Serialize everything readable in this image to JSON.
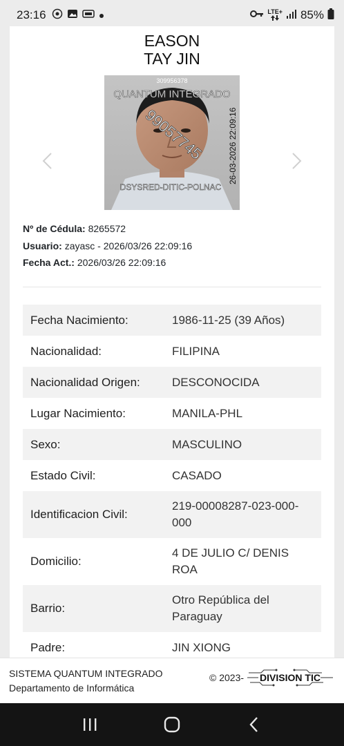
{
  "status_bar": {
    "time": "23:16",
    "lte_top": "LTE+",
    "battery": "85%"
  },
  "person": {
    "first_name": "EASON",
    "last_name": "TAY JIN"
  },
  "photo_overlay": {
    "top_number": "309956378",
    "system": "QUANTUM INTEGRADO",
    "diagonal_id": "99057745",
    "timestamp": "26-03-2026 22:09:16",
    "footer": "DSYSRED-DITIC-POLNAC"
  },
  "meta": {
    "cedula_label": "Nº de Cédula:",
    "cedula_value": "8265572",
    "usuario_label": "Usuario:",
    "usuario_value": "zayasc - 2026/03/26 22:09:16",
    "fecha_label": "Fecha Act.:",
    "fecha_value": "2026/03/26 22:09:16"
  },
  "details": [
    {
      "label": "Fecha Nacimiento:",
      "value": "1986-11-25 (39 Años)"
    },
    {
      "label": "Nacionalidad:",
      "value": "FILIPINA"
    },
    {
      "label": "Nacionalidad Origen:",
      "value": "DESCONOCIDA"
    },
    {
      "label": "Lugar Nacimiento:",
      "value": "MANILA-PHL"
    },
    {
      "label": "Sexo:",
      "value": "MASCULINO"
    },
    {
      "label": "Estado Civil:",
      "value": "CASADO"
    },
    {
      "label": "Identificacion Civil:",
      "value": "219-00008287-023-000-000"
    },
    {
      "label": "Domicilio:",
      "value": "4 DE JULIO C/ DENIS ROA"
    },
    {
      "label": "Barrio:",
      "value": "Otro República del Paraguay"
    },
    {
      "label": "Padre:",
      "value": "JIN XIONG"
    }
  ],
  "footer": {
    "system_name": "SISTEMA QUANTUM INTEGRADO",
    "department": "Departamento de Informática",
    "copyright": "© 2023-",
    "logo_text": "DIVISION TIC"
  }
}
